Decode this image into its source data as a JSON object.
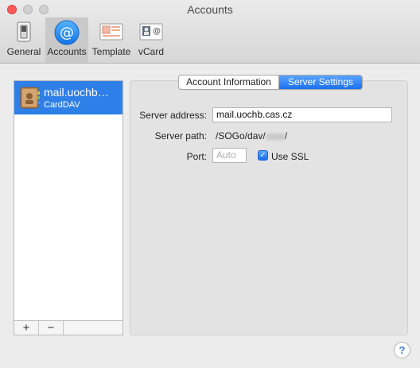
{
  "window": {
    "title": "Accounts"
  },
  "toolbar": {
    "items": [
      {
        "label": "General",
        "icon": "general-switch-icon"
      },
      {
        "label": "Accounts",
        "icon": "at-sign-icon",
        "selected": true
      },
      {
        "label": "Template",
        "icon": "template-icon"
      },
      {
        "label": "vCard",
        "icon": "vcard-icon"
      }
    ]
  },
  "sidebar": {
    "accounts": [
      {
        "name": "mail.uochb…",
        "type": "CardDAV",
        "icon": "address-book-icon",
        "selected": true
      }
    ],
    "add_label": "+",
    "remove_label": "−"
  },
  "tabs": {
    "account_information": "Account Information",
    "server_settings": "Server Settings",
    "selected": "Server Settings"
  },
  "server": {
    "address_label": "Server address:",
    "address_value": "mail.uochb.cas.cz",
    "path_label": "Server path:",
    "path_prefix": "/SOGo/dav/",
    "path_suffix": "/",
    "port_label": "Port:",
    "port_placeholder": "Auto",
    "ssl_label": "Use SSL",
    "ssl_checked": true
  },
  "help": {
    "label": "?"
  },
  "colors": {
    "accent": "#2f7fe9",
    "close_button": "#fc5b57"
  }
}
